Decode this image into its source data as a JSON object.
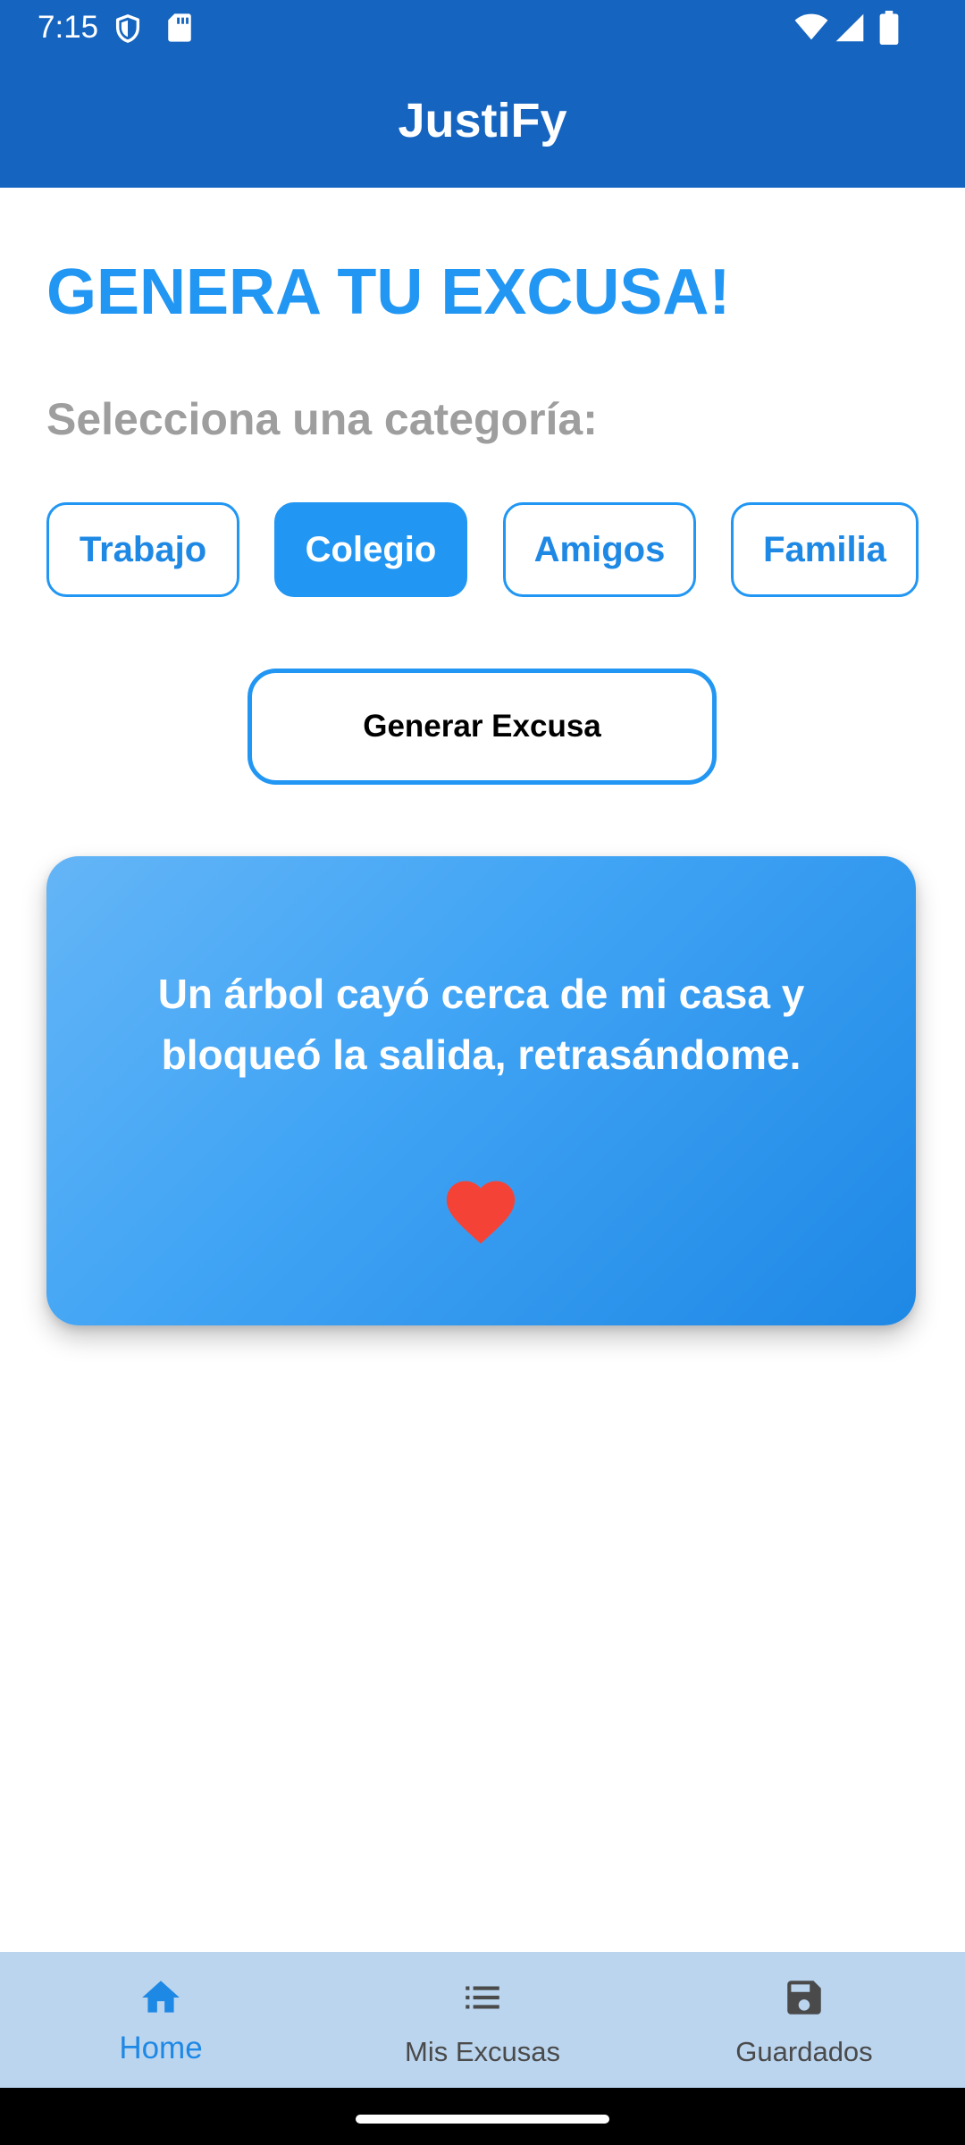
{
  "status_bar": {
    "time": "7:15",
    "icons": [
      "shield-icon",
      "sd-card-icon",
      "wifi-icon",
      "signal-icon",
      "battery-icon"
    ]
  },
  "app_bar": {
    "title": "JustiFy",
    "color": "#1565C0"
  },
  "main": {
    "headline": "GENERA TU EXCUSA!",
    "subtitle": "Selecciona una categoría:",
    "categories": [
      {
        "label": "Trabajo",
        "selected": false
      },
      {
        "label": "Colegio",
        "selected": true
      },
      {
        "label": "Amigos",
        "selected": false
      },
      {
        "label": "Familia",
        "selected": false
      }
    ],
    "generate_label": "Generar Excusa",
    "excuse_card": {
      "text": "Un árbol cayó cerca de mi casa y bloqueó la salida, retrasándome.",
      "favorite_icon": "heart-icon",
      "favorite_color": "#F44336"
    },
    "accent_color": "#2196F3"
  },
  "bottom_nav": {
    "items": [
      {
        "label": "Home",
        "icon": "home-icon",
        "active": true
      },
      {
        "label": "Mis Excusas",
        "icon": "list-icon",
        "active": false
      },
      {
        "label": "Guardados",
        "icon": "save-icon",
        "active": false
      }
    ]
  }
}
